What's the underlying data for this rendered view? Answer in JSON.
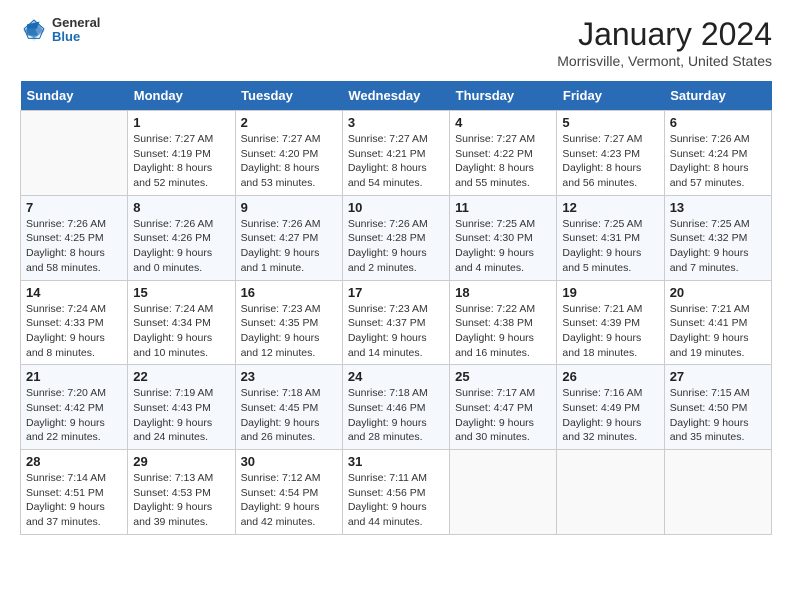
{
  "header": {
    "logo": {
      "general": "General",
      "blue": "Blue"
    },
    "title": "January 2024",
    "subtitle": "Morrisville, Vermont, United States"
  },
  "weekdays": [
    "Sunday",
    "Monday",
    "Tuesday",
    "Wednesday",
    "Thursday",
    "Friday",
    "Saturday"
  ],
  "weeks": [
    [
      {
        "day": "",
        "sunrise": "",
        "sunset": "",
        "daylight": ""
      },
      {
        "day": "1",
        "sunrise": "Sunrise: 7:27 AM",
        "sunset": "Sunset: 4:19 PM",
        "daylight": "Daylight: 8 hours and 52 minutes."
      },
      {
        "day": "2",
        "sunrise": "Sunrise: 7:27 AM",
        "sunset": "Sunset: 4:20 PM",
        "daylight": "Daylight: 8 hours and 53 minutes."
      },
      {
        "day": "3",
        "sunrise": "Sunrise: 7:27 AM",
        "sunset": "Sunset: 4:21 PM",
        "daylight": "Daylight: 8 hours and 54 minutes."
      },
      {
        "day": "4",
        "sunrise": "Sunrise: 7:27 AM",
        "sunset": "Sunset: 4:22 PM",
        "daylight": "Daylight: 8 hours and 55 minutes."
      },
      {
        "day": "5",
        "sunrise": "Sunrise: 7:27 AM",
        "sunset": "Sunset: 4:23 PM",
        "daylight": "Daylight: 8 hours and 56 minutes."
      },
      {
        "day": "6",
        "sunrise": "Sunrise: 7:26 AM",
        "sunset": "Sunset: 4:24 PM",
        "daylight": "Daylight: 8 hours and 57 minutes."
      }
    ],
    [
      {
        "day": "7",
        "sunrise": "Sunrise: 7:26 AM",
        "sunset": "Sunset: 4:25 PM",
        "daylight": "Daylight: 8 hours and 58 minutes."
      },
      {
        "day": "8",
        "sunrise": "Sunrise: 7:26 AM",
        "sunset": "Sunset: 4:26 PM",
        "daylight": "Daylight: 9 hours and 0 minutes."
      },
      {
        "day": "9",
        "sunrise": "Sunrise: 7:26 AM",
        "sunset": "Sunset: 4:27 PM",
        "daylight": "Daylight: 9 hours and 1 minute."
      },
      {
        "day": "10",
        "sunrise": "Sunrise: 7:26 AM",
        "sunset": "Sunset: 4:28 PM",
        "daylight": "Daylight: 9 hours and 2 minutes."
      },
      {
        "day": "11",
        "sunrise": "Sunrise: 7:25 AM",
        "sunset": "Sunset: 4:30 PM",
        "daylight": "Daylight: 9 hours and 4 minutes."
      },
      {
        "day": "12",
        "sunrise": "Sunrise: 7:25 AM",
        "sunset": "Sunset: 4:31 PM",
        "daylight": "Daylight: 9 hours and 5 minutes."
      },
      {
        "day": "13",
        "sunrise": "Sunrise: 7:25 AM",
        "sunset": "Sunset: 4:32 PM",
        "daylight": "Daylight: 9 hours and 7 minutes."
      }
    ],
    [
      {
        "day": "14",
        "sunrise": "Sunrise: 7:24 AM",
        "sunset": "Sunset: 4:33 PM",
        "daylight": "Daylight: 9 hours and 8 minutes."
      },
      {
        "day": "15",
        "sunrise": "Sunrise: 7:24 AM",
        "sunset": "Sunset: 4:34 PM",
        "daylight": "Daylight: 9 hours and 10 minutes."
      },
      {
        "day": "16",
        "sunrise": "Sunrise: 7:23 AM",
        "sunset": "Sunset: 4:35 PM",
        "daylight": "Daylight: 9 hours and 12 minutes."
      },
      {
        "day": "17",
        "sunrise": "Sunrise: 7:23 AM",
        "sunset": "Sunset: 4:37 PM",
        "daylight": "Daylight: 9 hours and 14 minutes."
      },
      {
        "day": "18",
        "sunrise": "Sunrise: 7:22 AM",
        "sunset": "Sunset: 4:38 PM",
        "daylight": "Daylight: 9 hours and 16 minutes."
      },
      {
        "day": "19",
        "sunrise": "Sunrise: 7:21 AM",
        "sunset": "Sunset: 4:39 PM",
        "daylight": "Daylight: 9 hours and 18 minutes."
      },
      {
        "day": "20",
        "sunrise": "Sunrise: 7:21 AM",
        "sunset": "Sunset: 4:41 PM",
        "daylight": "Daylight: 9 hours and 19 minutes."
      }
    ],
    [
      {
        "day": "21",
        "sunrise": "Sunrise: 7:20 AM",
        "sunset": "Sunset: 4:42 PM",
        "daylight": "Daylight: 9 hours and 22 minutes."
      },
      {
        "day": "22",
        "sunrise": "Sunrise: 7:19 AM",
        "sunset": "Sunset: 4:43 PM",
        "daylight": "Daylight: 9 hours and 24 minutes."
      },
      {
        "day": "23",
        "sunrise": "Sunrise: 7:18 AM",
        "sunset": "Sunset: 4:45 PM",
        "daylight": "Daylight: 9 hours and 26 minutes."
      },
      {
        "day": "24",
        "sunrise": "Sunrise: 7:18 AM",
        "sunset": "Sunset: 4:46 PM",
        "daylight": "Daylight: 9 hours and 28 minutes."
      },
      {
        "day": "25",
        "sunrise": "Sunrise: 7:17 AM",
        "sunset": "Sunset: 4:47 PM",
        "daylight": "Daylight: 9 hours and 30 minutes."
      },
      {
        "day": "26",
        "sunrise": "Sunrise: 7:16 AM",
        "sunset": "Sunset: 4:49 PM",
        "daylight": "Daylight: 9 hours and 32 minutes."
      },
      {
        "day": "27",
        "sunrise": "Sunrise: 7:15 AM",
        "sunset": "Sunset: 4:50 PM",
        "daylight": "Daylight: 9 hours and 35 minutes."
      }
    ],
    [
      {
        "day": "28",
        "sunrise": "Sunrise: 7:14 AM",
        "sunset": "Sunset: 4:51 PM",
        "daylight": "Daylight: 9 hours and 37 minutes."
      },
      {
        "day": "29",
        "sunrise": "Sunrise: 7:13 AM",
        "sunset": "Sunset: 4:53 PM",
        "daylight": "Daylight: 9 hours and 39 minutes."
      },
      {
        "day": "30",
        "sunrise": "Sunrise: 7:12 AM",
        "sunset": "Sunset: 4:54 PM",
        "daylight": "Daylight: 9 hours and 42 minutes."
      },
      {
        "day": "31",
        "sunrise": "Sunrise: 7:11 AM",
        "sunset": "Sunset: 4:56 PM",
        "daylight": "Daylight: 9 hours and 44 minutes."
      },
      {
        "day": "",
        "sunrise": "",
        "sunset": "",
        "daylight": ""
      },
      {
        "day": "",
        "sunrise": "",
        "sunset": "",
        "daylight": ""
      },
      {
        "day": "",
        "sunrise": "",
        "sunset": "",
        "daylight": ""
      }
    ]
  ]
}
